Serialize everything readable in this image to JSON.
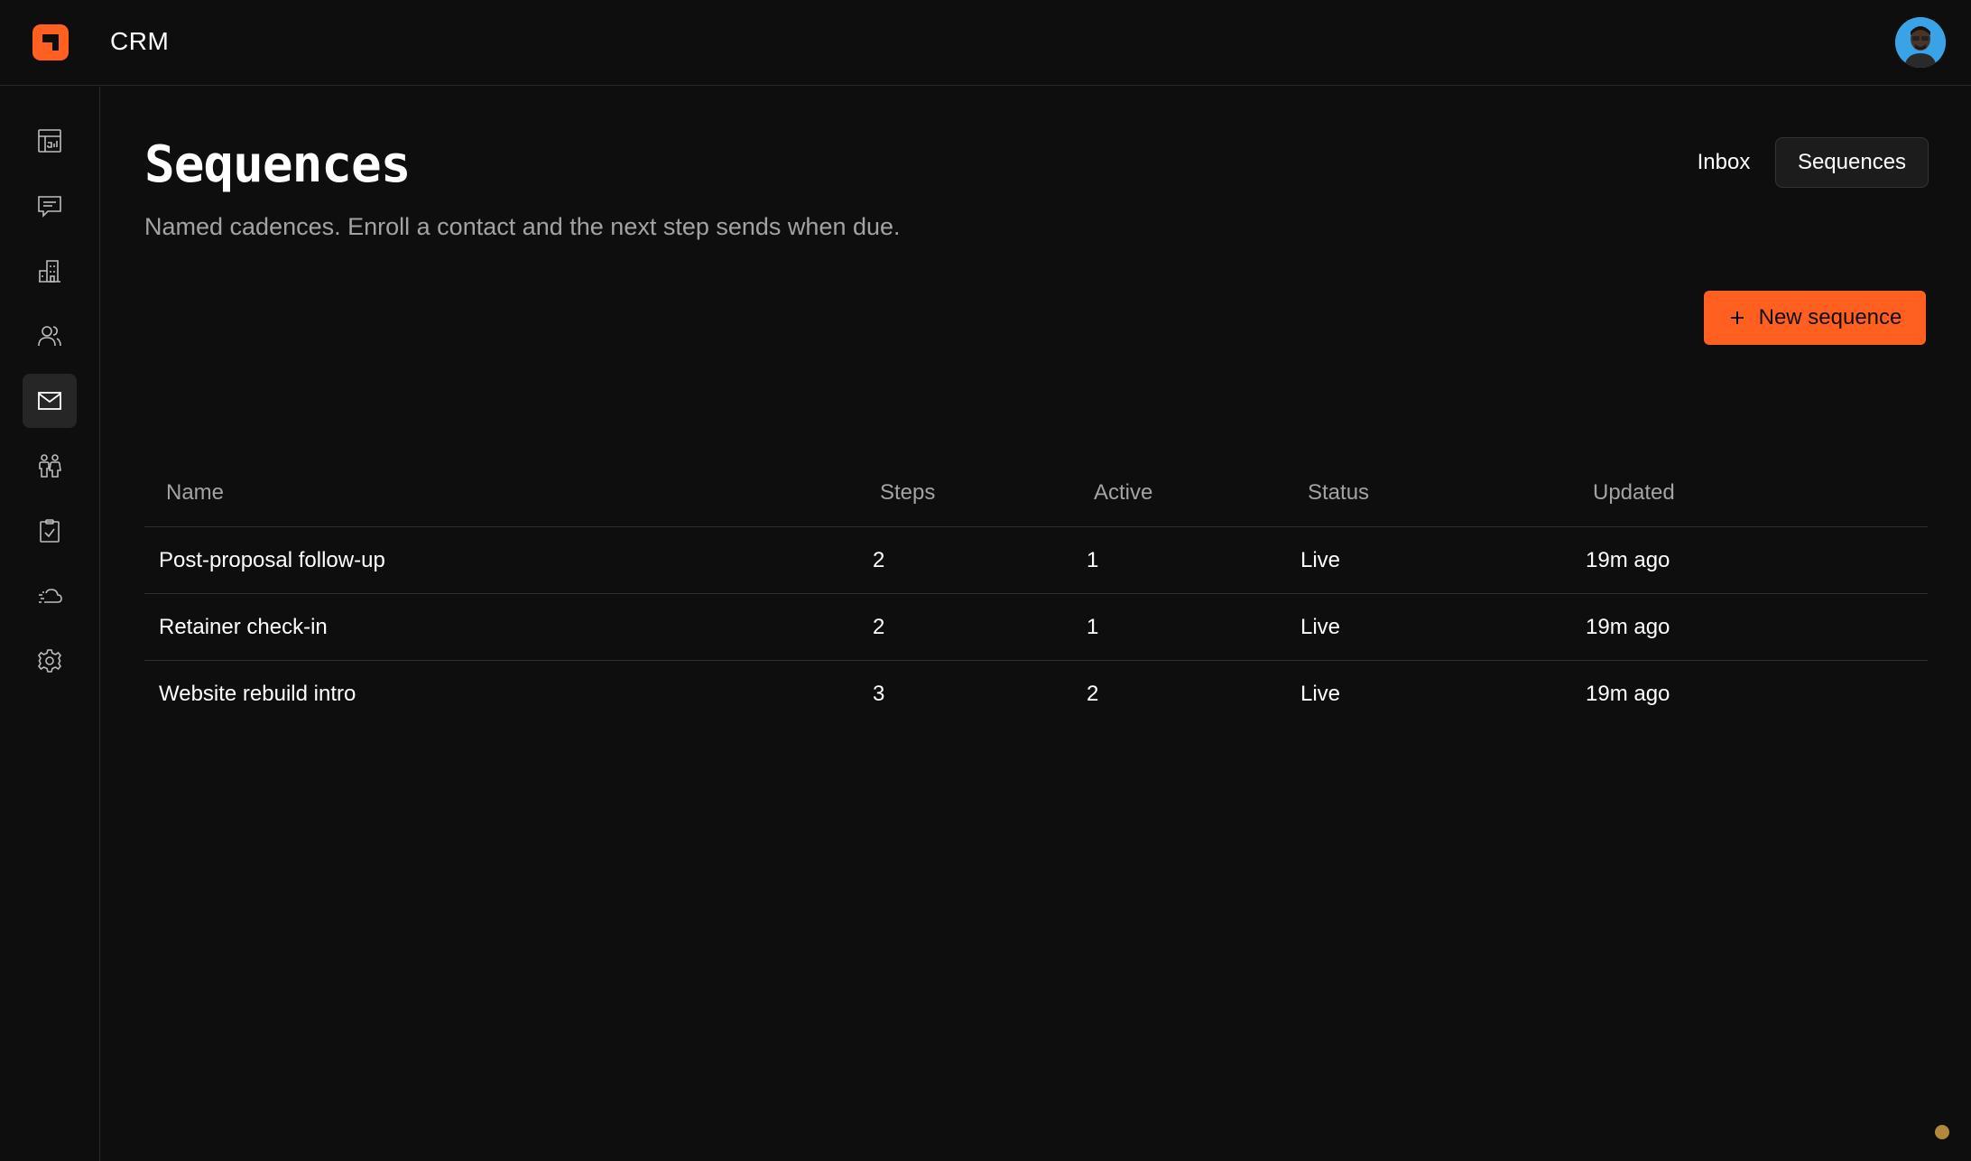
{
  "header": {
    "app_title": "CRM",
    "logo_icon": "logo-icon",
    "avatar_icon": "user-avatar",
    "brand_color": "#ff5f1f"
  },
  "sidebar": {
    "items": [
      {
        "icon": "dashboard-icon",
        "active": false
      },
      {
        "icon": "chat-icon",
        "active": false
      },
      {
        "icon": "building-icon",
        "active": false
      },
      {
        "icon": "contacts-icon",
        "active": false
      },
      {
        "icon": "mail-icon",
        "active": true
      },
      {
        "icon": "people-icon",
        "active": false
      },
      {
        "icon": "clipboard-check-icon",
        "active": false
      },
      {
        "icon": "cloud-icon",
        "active": false
      },
      {
        "icon": "gear-icon",
        "active": false
      }
    ]
  },
  "page": {
    "title": "Sequences",
    "subtitle": "Named cadences. Enroll a contact and the next step sends when due.",
    "tabs": [
      {
        "label": "Inbox",
        "selected": false
      },
      {
        "label": "Sequences",
        "selected": true
      }
    ],
    "new_button_label": "New sequence",
    "new_button_icon": "plus-icon"
  },
  "table": {
    "columns": [
      "Name",
      "Steps",
      "Active",
      "Status",
      "Updated"
    ],
    "rows": [
      {
        "name": "Post-proposal follow-up",
        "steps": "2",
        "active": "1",
        "status": "Live",
        "updated": "19m ago"
      },
      {
        "name": "Retainer check-in",
        "steps": "2",
        "active": "1",
        "status": "Live",
        "updated": "19m ago"
      },
      {
        "name": "Website rebuild intro",
        "steps": "3",
        "active": "2",
        "status": "Live",
        "updated": "19m ago"
      }
    ]
  }
}
